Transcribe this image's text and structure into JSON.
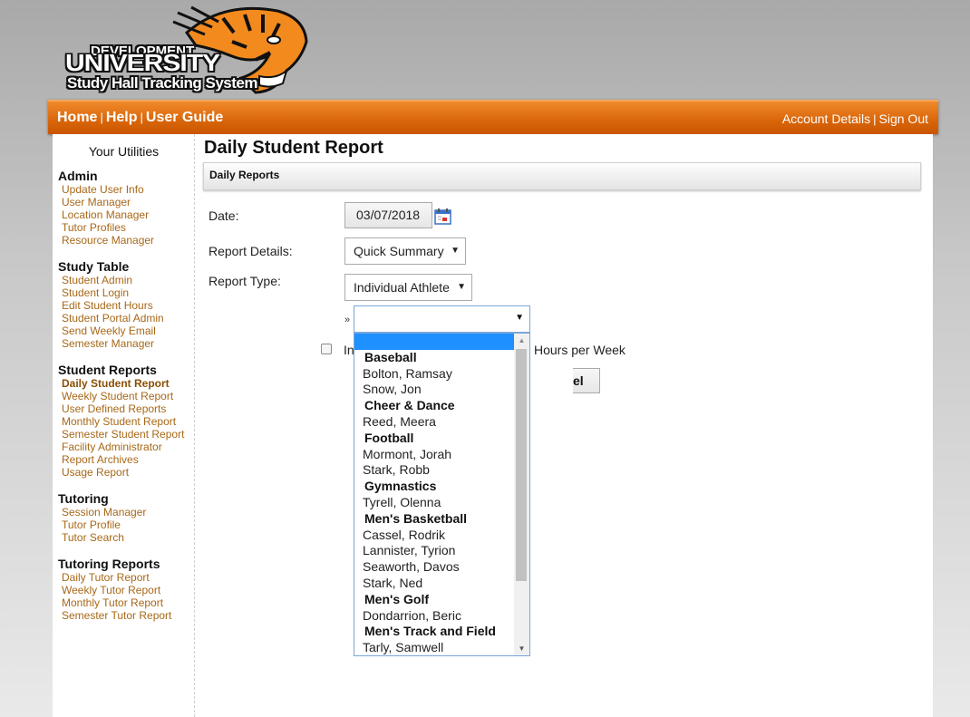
{
  "logo": {
    "line1": "DEVELOPMENT",
    "line2": "UNIVERSITY",
    "line3": "Study Hall Tracking System"
  },
  "topnav": {
    "home": "Home",
    "help": "Help",
    "user_guide": "User Guide",
    "separator": "|",
    "account_details": "Account Details",
    "sign_out": "Sign Out"
  },
  "sidebar": {
    "title": "Your Utilities",
    "groups": [
      {
        "heading": "Admin",
        "items": [
          "Update User Info",
          "User Manager",
          "Location Manager",
          "Tutor Profiles",
          "Resource Manager"
        ]
      },
      {
        "heading": "Study Table",
        "items": [
          "Student Admin",
          "Student Login",
          "Edit Student Hours",
          "Student Portal Admin",
          "Send Weekly Email",
          "Semester Manager"
        ]
      },
      {
        "heading": "Student Reports",
        "items": [
          "Daily Student Report",
          "Weekly Student Report",
          "User Defined Reports",
          "Monthly Student Report",
          "Semester Student Report",
          "Facility Administrator",
          "Report Archives",
          "Usage Report"
        ]
      },
      {
        "heading": "Tutoring",
        "items": [
          "Session Manager",
          "Tutor Profile",
          "Tutor Search"
        ]
      },
      {
        "heading": "Tutoring Reports",
        "items": [
          "Daily Tutor Report",
          "Weekly Tutor Report",
          "Monthly Tutor Report",
          "Semester Tutor Report"
        ]
      }
    ],
    "active_item": "Daily Student Report"
  },
  "main": {
    "title": "Daily Student Report",
    "section": "Daily Reports",
    "date_label": "Date:",
    "date_value": "03/07/2018",
    "details_label": "Report Details:",
    "details_value": "Quick Summary",
    "type_label": "Report Type:",
    "type_value": "Individual Athlete",
    "raquo": "»",
    "checkbox_partial": "In",
    "checkbox_tail": "Hours per Week",
    "cancel_partial": "el"
  },
  "dropdown": {
    "selected": "",
    "options": [
      {
        "type": "blank",
        "label": ""
      },
      {
        "type": "group",
        "label": "Baseball"
      },
      {
        "type": "opt",
        "label": "Bolton, Ramsay"
      },
      {
        "type": "opt",
        "label": "Snow, Jon"
      },
      {
        "type": "group",
        "label": "Cheer & Dance"
      },
      {
        "type": "opt",
        "label": "Reed, Meera"
      },
      {
        "type": "group",
        "label": "Football"
      },
      {
        "type": "opt",
        "label": "Mormont, Jorah"
      },
      {
        "type": "opt",
        "label": "Stark, Robb"
      },
      {
        "type": "group",
        "label": "Gymnastics"
      },
      {
        "type": "opt",
        "label": "Tyrell, Olenna"
      },
      {
        "type": "group",
        "label": "Men's Basketball"
      },
      {
        "type": "opt",
        "label": "Cassel, Rodrik"
      },
      {
        "type": "opt",
        "label": "Lannister, Tyrion"
      },
      {
        "type": "opt",
        "label": "Seaworth, Davos"
      },
      {
        "type": "opt",
        "label": "Stark, Ned"
      },
      {
        "type": "group",
        "label": "Men's Golf"
      },
      {
        "type": "opt",
        "label": "Dondarrion, Beric"
      },
      {
        "type": "group",
        "label": "Men's Track and Field"
      },
      {
        "type": "opt",
        "label": "Tarly, Samwell"
      }
    ]
  },
  "colors": {
    "accent_orange": "#d9650a",
    "link": "#a86818",
    "highlight": "#1e90ff"
  },
  "icons": {
    "calendar": "calendar-icon",
    "tiger": "tiger-logo",
    "dropdown_arrow": "chevron-down-icon"
  }
}
